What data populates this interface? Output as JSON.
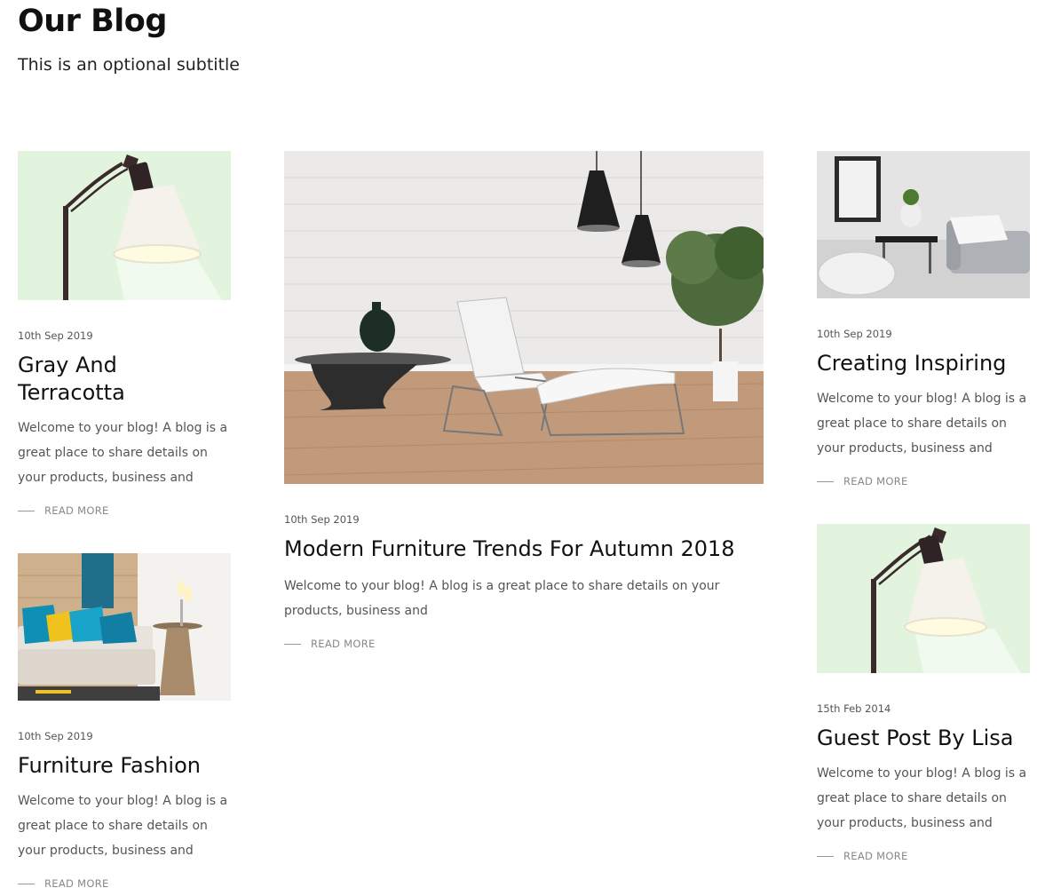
{
  "header": {
    "title": "Our Blog",
    "subtitle": "This is an optional subtitle"
  },
  "read_more_label": "READ MORE",
  "posts": [
    {
      "date": "10th Sep 2019",
      "title": "Gray And Terracotta",
      "excerpt": "Welcome to your blog! A blog is a great place to share details on your products, business and",
      "image": "floor-lamp-image"
    },
    {
      "date": "10th Sep 2019",
      "title": "Modern Furniture Trends For Autumn 2018",
      "excerpt": "Welcome to your blog! A blog is a great place to share details on your products, business and",
      "image": "living-room-chairs-image"
    },
    {
      "date": "10th Sep 2019",
      "title": "Creating Inspiring",
      "excerpt": "Welcome to your blog! A blog is a great place to share details on your products, business and",
      "image": "gray-living-room-image"
    },
    {
      "date": "10th Sep 2019",
      "title": "Furniture Fashion",
      "excerpt": "Welcome to your blog! A blog is a great place to share details on your products, business and",
      "image": "sofa-cushions-image"
    },
    {
      "date": "15th Feb 2014",
      "title": "Guest Post By Lisa",
      "excerpt": "Welcome to your blog! A blog is a great place to share details on your products, business and",
      "image": "floor-lamp-image"
    }
  ],
  "colors": {
    "lamp_background": "#e3f4de",
    "text_primary": "#111111",
    "text_muted": "#555555",
    "read_more": "#888888"
  }
}
